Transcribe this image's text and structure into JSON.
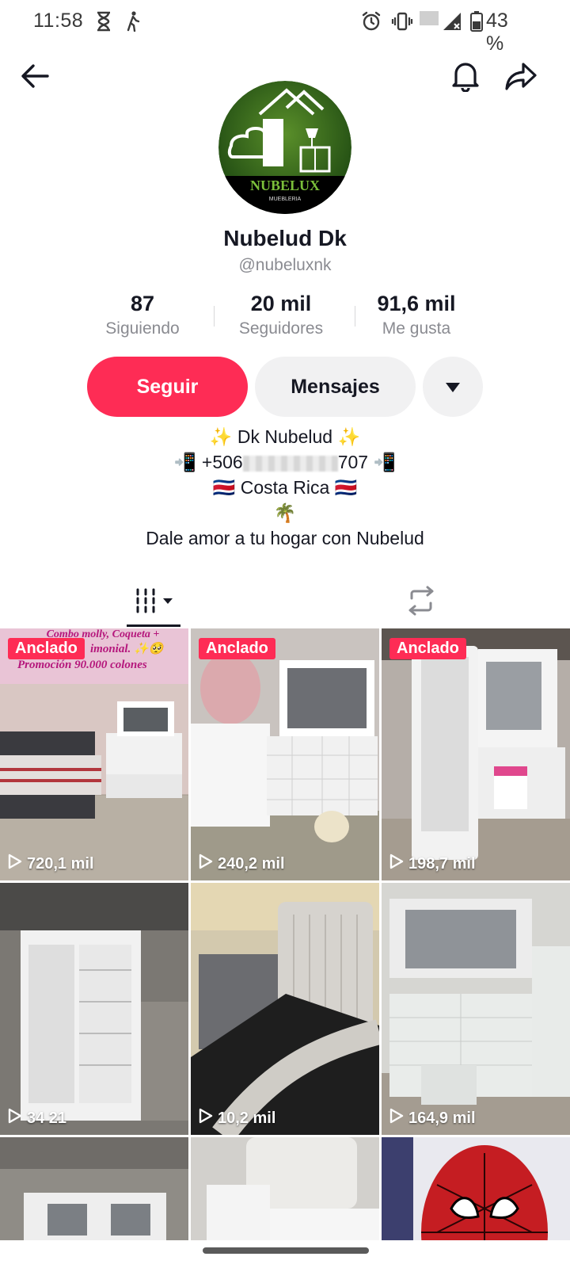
{
  "status_bar": {
    "time": "11:58",
    "battery": "43 %"
  },
  "profile": {
    "display_name": "Nubelud Dk",
    "username": "@nubeluxnk",
    "avatar_logo": "NUBELUX",
    "avatar_sub": "MUEBLERIA"
  },
  "stats": [
    {
      "value": "87",
      "label": "Siguiendo"
    },
    {
      "value": "20 mil",
      "label": "Seguidores"
    },
    {
      "value": "91,6 mil",
      "label": "Me gusta"
    }
  ],
  "actions": {
    "follow_label": "Seguir",
    "message_label": "Mensajes"
  },
  "bio": {
    "line1": "✨ Dk Nubelud ✨",
    "line2_prefix": "📲 +506",
    "line2_suffix": "707 📲",
    "line3": "🇨🇷 Costa Rica 🇨🇷",
    "line4": "🌴",
    "line5": "Dale amor a tu hogar con Nubelud"
  },
  "tabs": [
    {
      "name": "videos-tab",
      "icon": "grid-icon"
    },
    {
      "name": "reposts-tab",
      "icon": "repost-icon"
    }
  ],
  "videos": [
    {
      "pinned": "Anclado",
      "views": "720,1 mil",
      "overlay1": "Combo molly, Coqueta +",
      "overlay2": "imonial. ✨🥺",
      "overlay3": "Promoción 90.000 colones"
    },
    {
      "pinned": "Anclado",
      "views": "240,2 mil"
    },
    {
      "pinned": "Anclado",
      "views": "198,7 mil"
    },
    {
      "pinned": "",
      "views": "34 21"
    },
    {
      "pinned": "",
      "views": "10,2 mil"
    },
    {
      "pinned": "",
      "views": "164,9 mil"
    },
    {
      "pinned": "",
      "views": ""
    },
    {
      "pinned": "",
      "views": ""
    },
    {
      "pinned": "",
      "views": ""
    }
  ],
  "colors": {
    "accent": "#fe2c55",
    "secondary_button": "#f1f1f2",
    "muted_text": "#8a8b91"
  }
}
